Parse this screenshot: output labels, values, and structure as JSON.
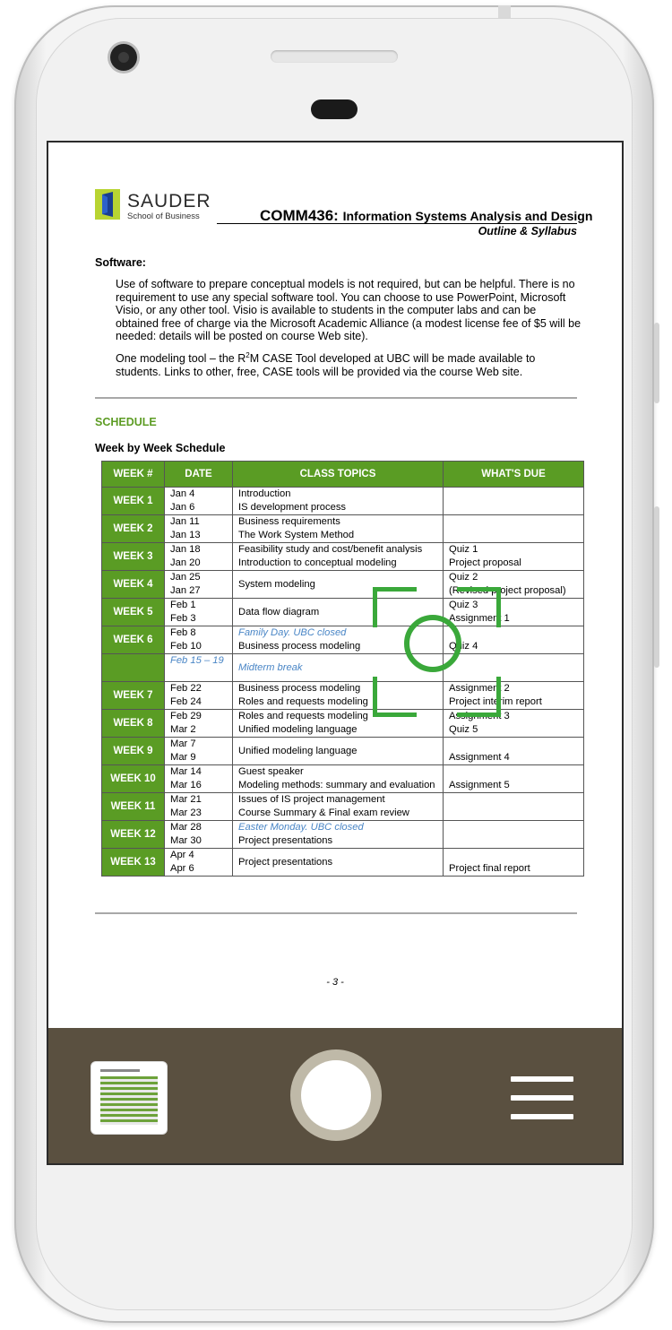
{
  "document": {
    "logo": {
      "name": "SAUDER",
      "sub": "School of Business"
    },
    "course_code": "COMM436:",
    "course_title": "Information Systems Analysis and Design",
    "subtitle": "Outline & Syllabus",
    "software_heading": "Software:",
    "software_p1": "Use of software to prepare conceptual models is not required, but can be helpful. There is no requirement to use any special software tool. You can choose to use PowerPoint, Microsoft Visio, or any other tool. Visio is available to students in the computer labs and can be obtained free of charge via the Microsoft Academic Alliance (a modest license fee of $5 will be needed: details will be posted on course Web site).",
    "software_p2_before": "One modeling tool – the R",
    "software_p2_sup": "2",
    "software_p2_after": "M CASE Tool developed at UBC will be made available to students. Links to other, free, CASE tools will be provided via the course Web site.",
    "schedule_heading": "SCHEDULE",
    "week_heading": "Week by Week Schedule",
    "table": {
      "headers": [
        "WEEK #",
        "DATE",
        "CLASS TOPICS",
        "WHAT'S DUE"
      ],
      "rows": [
        {
          "week": "WEEK 1",
          "date1": "Jan 4",
          "date2": "Jan 6",
          "topic1": "Introduction",
          "topic2": "IS development process",
          "due1": "",
          "due2": ""
        },
        {
          "week": "WEEK 2",
          "date1": "Jan 11",
          "date2": "Jan 13",
          "topic1": "Business requirements",
          "topic2": "The Work System Method",
          "due1": "",
          "due2": ""
        },
        {
          "week": "WEEK 3",
          "date1": "Jan 18",
          "date2": "Jan 20",
          "topic1": "Feasibility study and cost/benefit analysis",
          "topic2": "Introduction to conceptual modeling",
          "due1": "Quiz 1",
          "due2": "Project proposal"
        },
        {
          "week": "WEEK 4",
          "date1": "Jan 25",
          "date2": "Jan 27",
          "topic1": "System modeling",
          "topic2": "",
          "due1": "Quiz 2",
          "due2": "(Revised project proposal)"
        },
        {
          "week": "WEEK 5",
          "date1": "Feb 1",
          "date2": "Feb 3",
          "topic1": "Data flow diagram",
          "topic2": "",
          "due1": "Quiz 3",
          "due2": "Assignment 1"
        },
        {
          "week": "WEEK 6",
          "date1": "Feb 8",
          "date2": "Feb 10",
          "topic1": "Family Day. UBC closed",
          "topic2": "Business process modeling",
          "due1": "",
          "due2": "Quiz 4"
        },
        {
          "week": "",
          "date1": "Feb 15 – 19",
          "date2": "",
          "topic1": "Midterm break",
          "topic2": "",
          "due1": "",
          "due2": ""
        },
        {
          "week": "WEEK 7",
          "date1": "Feb 22",
          "date2": "Feb 24",
          "topic1": "Business process modeling",
          "topic2": "Roles and requests modeling",
          "due1": "Assignment 2",
          "due2": "Project interim report"
        },
        {
          "week": "WEEK 8",
          "date1": "Feb 29",
          "date2": "Mar 2",
          "topic1": "Roles and requests modeling",
          "topic2": "Unified modeling language",
          "due1": "Assignment 3",
          "due2": "Quiz 5"
        },
        {
          "week": "WEEK 9",
          "date1": "Mar 7",
          "date2": "Mar 9",
          "topic1": "Unified modeling language",
          "topic2": "",
          "due1": "",
          "due2": "Assignment 4"
        },
        {
          "week": "WEEK 10",
          "date1": "Mar 14",
          "date2": "Mar 16",
          "topic1": "Guest speaker",
          "topic2": "Modeling methods: summary and evaluation",
          "due1": "",
          "due2": "Assignment 5"
        },
        {
          "week": "WEEK 11",
          "date1": "Mar 21",
          "date2": "Mar 23",
          "topic1": "Issues of IS project management",
          "topic2": "Course Summary & Final exam review",
          "due1": "",
          "due2": ""
        },
        {
          "week": "WEEK 12",
          "date1": "Mar 28",
          "date2": "Mar 30",
          "topic1": "Easter Monday. UBC closed",
          "topic2": "Project presentations",
          "due1": "",
          "due2": ""
        },
        {
          "week": "WEEK 13",
          "date1": "Apr 4",
          "date2": "Apr 6",
          "topic1": "Project presentations",
          "topic2": "",
          "due1": "",
          "due2": "Project final report"
        }
      ]
    },
    "page_number": "- 3 -"
  },
  "camera_bar": {
    "thumbnail_icon": "document-thumbnail-icon",
    "shutter_icon": "shutter-button-icon",
    "menu_icon": "hamburger-menu-icon"
  },
  "colors": {
    "accent_green": "#5a9c24",
    "reticle_green": "#3aa83a",
    "bar_brown": "#5a5040",
    "holiday_blue": "#4a86c6"
  }
}
